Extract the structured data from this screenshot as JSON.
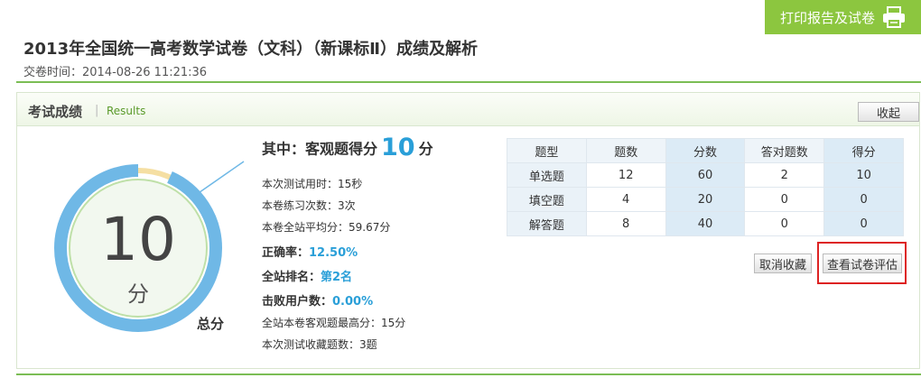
{
  "header": {
    "print_button_label": "打印报告及试卷",
    "title": "2013年全国统一高考数学试卷（文科）（新课标Ⅱ）成绩及解析",
    "submit_time": "交卷时间：2014-08-26 11:21:36"
  },
  "panel": {
    "title": "考试成绩",
    "subtitle": "Results",
    "collapse_label": "收起"
  },
  "score": {
    "value": "10",
    "unit": "分",
    "total_label": "总分",
    "ratio": 0.0667
  },
  "summary": {
    "objective_label": "其中：客观题得分",
    "objective_value": "10",
    "objective_unit": "分",
    "time_used": "本次测试用时：15秒",
    "practice_count": "本卷练习次数：3次",
    "site_average": "本卷全站平均分：59.67分",
    "accuracy_label": "正确率：",
    "accuracy_value": "12.50%",
    "rank_label": "全站排名：",
    "rank_value": "第2名",
    "beat_label": "击败用户数：",
    "beat_value": "0.00%",
    "max_objective": "全站本卷客观题最高分：15分",
    "favorites_count": "本次测试收藏题数：3题"
  },
  "table": {
    "headers": [
      "题型",
      "题数",
      "分数",
      "答对题数",
      "得分"
    ],
    "rows": [
      [
        "单选题",
        "12",
        "60",
        "2",
        "10"
      ],
      [
        "填空题",
        "4",
        "20",
        "0",
        "0"
      ],
      [
        "解答题",
        "8",
        "40",
        "0",
        "0"
      ]
    ]
  },
  "actions": {
    "unfavorite_label": "取消收藏",
    "view_eval_label": "查看试卷评估"
  },
  "colors": {
    "brand_green": "#8cc63f",
    "accent_blue": "#2a9fd8",
    "ring_blue": "#6fb8e6",
    "ring_yellow": "#f5dfa3",
    "highlight_red": "#dd2222"
  }
}
